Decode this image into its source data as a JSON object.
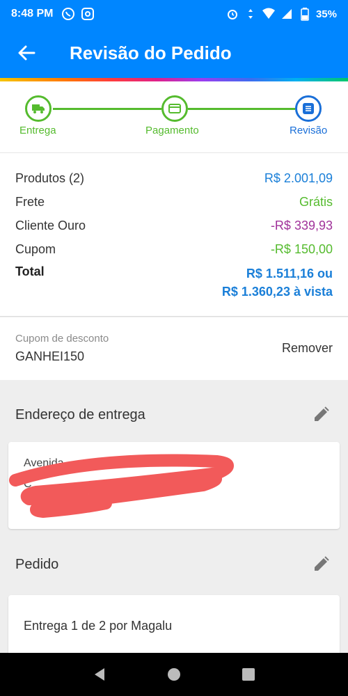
{
  "status_bar": {
    "time": "8:48 PM",
    "battery": "35%",
    "icons_left": [
      "whatsapp-icon",
      "app-icon"
    ],
    "icons_right": [
      "alarm-icon",
      "data-arrows-icon",
      "wifi-icon",
      "signal-icon",
      "battery-icon"
    ]
  },
  "app_bar": {
    "title": "Revisão do Pedido",
    "back_icon": "arrow-left-icon"
  },
  "stepper": {
    "steps": [
      {
        "label": "Entrega",
        "icon": "truck-icon",
        "state": "done"
      },
      {
        "label": "Pagamento",
        "icon": "card-icon",
        "state": "done"
      },
      {
        "label": "Revisão",
        "icon": "list-icon",
        "state": "current"
      }
    ],
    "colors": {
      "done": "#55bb2e",
      "current": "#1a6fd8"
    }
  },
  "summary": {
    "products_label": "Produtos (2)",
    "products_value": "R$ 2.001,09",
    "shipping_label": "Frete",
    "shipping_value": "Grátis",
    "gold_label": "Cliente Ouro",
    "gold_value": "-R$ 339,93",
    "coupon_label": "Cupom",
    "coupon_value": "-R$ 150,00",
    "total_label": "Total",
    "total_value_1": "R$ 1.511,16 ou",
    "total_value_2": "R$ 1.360,23 à vista"
  },
  "coupon": {
    "label": "Cupom de desconto",
    "code": "GANHEI150",
    "remove_label": "Remover"
  },
  "address": {
    "title": "Endereço de entrega",
    "line1": "Avenida",
    "line2": "C"
  },
  "order": {
    "title": "Pedido",
    "delivery": "Entrega 1 de 2 por Magalu"
  },
  "colors": {
    "primary": "#0086ff",
    "green": "#55bb2e",
    "purple": "#a0329a",
    "blue_text": "#1a7fd8",
    "redaction": "#f25a5a"
  }
}
